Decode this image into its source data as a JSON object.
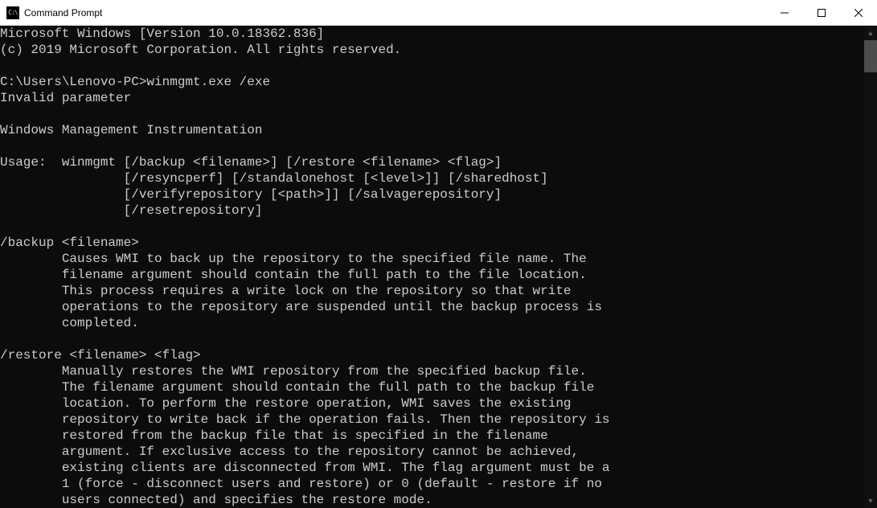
{
  "window": {
    "title": "Command Prompt",
    "icon_label": "C:\\"
  },
  "terminal": {
    "lines": [
      "Microsoft Windows [Version 10.0.18362.836]",
      "(c) 2019 Microsoft Corporation. All rights reserved.",
      "",
      "C:\\Users\\Lenovo-PC>winmgmt.exe /exe",
      "Invalid parameter",
      "",
      "Windows Management Instrumentation",
      "",
      "Usage:  winmgmt [/backup <filename>] [/restore <filename> <flag>]",
      "                [/resyncperf] [/standalonehost [<level>]] [/sharedhost]",
      "                [/verifyrepository [<path>]] [/salvagerepository]",
      "                [/resetrepository]",
      "",
      "/backup <filename>",
      "        Causes WMI to back up the repository to the specified file name. The",
      "        filename argument should contain the full path to the file location.",
      "        This process requires a write lock on the repository so that write",
      "        operations to the repository are suspended until the backup process is",
      "        completed.",
      "",
      "/restore <filename> <flag>",
      "        Manually restores the WMI repository from the specified backup file.",
      "        The filename argument should contain the full path to the backup file",
      "        location. To perform the restore operation, WMI saves the existing",
      "        repository to write back if the operation fails. Then the repository is",
      "        restored from the backup file that is specified in the filename",
      "        argument. If exclusive access to the repository cannot be achieved,",
      "        existing clients are disconnected from WMI. The flag argument must be a",
      "        1 (force - disconnect users and restore) or 0 (default - restore if no",
      "        users connected) and specifies the restore mode."
    ]
  }
}
